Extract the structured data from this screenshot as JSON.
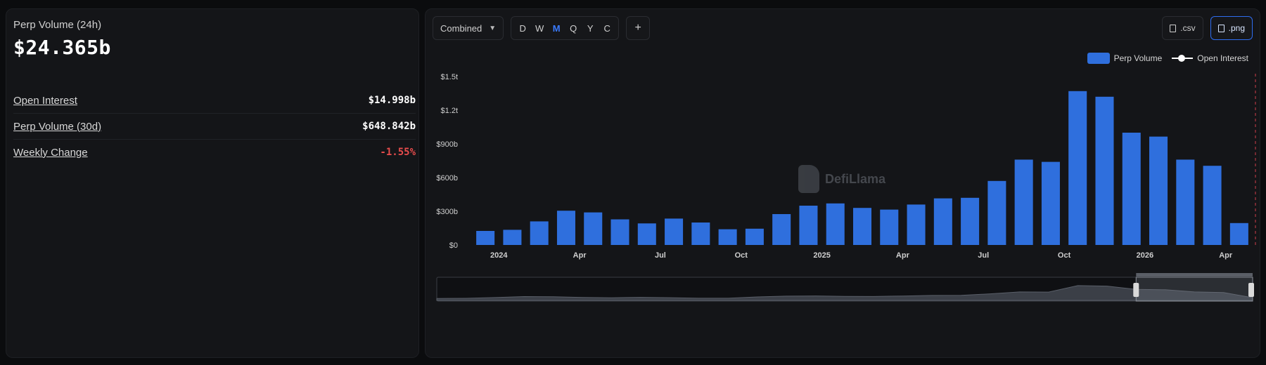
{
  "summary": {
    "volume_label": "Perp Volume (24h)",
    "volume_value": "$24.365b",
    "metrics": [
      {
        "label": "Open Interest",
        "value": "$14.998b",
        "negative": false
      },
      {
        "label": "Perp Volume (30d)",
        "value": "$648.842b",
        "negative": false
      },
      {
        "label": "Weekly Change",
        "value": "-1.55%",
        "negative": true
      }
    ]
  },
  "toolbar": {
    "mode_label": "Combined",
    "periods": [
      "D",
      "W",
      "M",
      "Q",
      "Y",
      "C"
    ],
    "active_period": "M",
    "add_label": "+",
    "csv_label": ".csv",
    "png_label": ".png"
  },
  "watermark": "DefiLlama",
  "colors": {
    "bar": "#2f6fdd",
    "negative": "#e74c4c",
    "accent": "#3a7bff"
  },
  "chart_data": {
    "type": "bar",
    "legend": [
      "Perp Volume",
      "Open Interest"
    ],
    "legend_position": "top-right",
    "x": [
      "2023-12",
      "2024-01",
      "2024-02",
      "2024-03",
      "2024-04",
      "2024-05",
      "2024-06",
      "2024-07",
      "2024-08",
      "2024-09",
      "2024-10",
      "2024-11",
      "2024-12",
      "2025-01",
      "2025-02",
      "2025-03",
      "2025-04",
      "2025-05",
      "2025-06",
      "2025-07",
      "2025-08",
      "2025-09",
      "2025-10",
      "2025-11",
      "2025-12",
      "2026-01",
      "2026-02",
      "2026-03",
      "2026-04"
    ],
    "series": [
      {
        "name": "Perp Volume",
        "values": [
          125,
          135,
          210,
          305,
          290,
          228,
          192,
          235,
          200,
          140,
          145,
          275,
          350,
          370,
          330,
          315,
          360,
          415,
          420,
          570,
          760,
          740,
          1370,
          1320,
          1000,
          965,
          760,
          705,
          195
        ]
      }
    ],
    "x_ticks": [
      {
        "label": "2024",
        "at": "2024-01"
      },
      {
        "label": "Apr",
        "at": "2024-04"
      },
      {
        "label": "Jul",
        "at": "2024-07"
      },
      {
        "label": "Oct",
        "at": "2024-10"
      },
      {
        "label": "2025",
        "at": "2025-01"
      },
      {
        "label": "Apr",
        "at": "2025-04"
      },
      {
        "label": "Jul",
        "at": "2025-07"
      },
      {
        "label": "Oct",
        "at": "2025-10"
      },
      {
        "label": "2026",
        "at": "2026-01"
      },
      {
        "label": "Apr",
        "at": "2026-04"
      }
    ],
    "y_ticks": [
      {
        "label": "$0",
        "value": 0
      },
      {
        "label": "$300b",
        "value": 300
      },
      {
        "label": "$600b",
        "value": 600
      },
      {
        "label": "$900b",
        "value": 900
      },
      {
        "label": "$1.2t",
        "value": 1200
      },
      {
        "label": "$1.5t",
        "value": 1500
      }
    ],
    "ylim": [
      0,
      1500
    ],
    "grid": false,
    "brush_selection": [
      "2025-12",
      "2026-04"
    ]
  }
}
